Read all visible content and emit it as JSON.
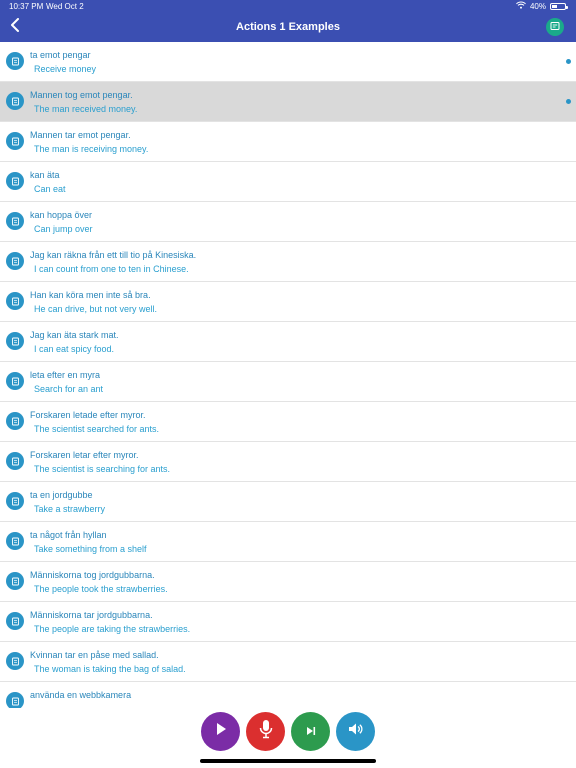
{
  "status_bar": {
    "time": "10:37 PM",
    "date": "Wed Oct 2",
    "battery_text": "40%",
    "battery_level": 0.4
  },
  "header": {
    "title": "Actions 1 Examples",
    "back_icon": "chevron-left-icon",
    "action_icon": "flashcard-icon"
  },
  "colors": {
    "nav_background": "#3b4fb2",
    "accent": "#2a95c7",
    "selected_row": "#d9d9d9",
    "play": "#7b2ca6",
    "record": "#db2f2f",
    "next": "#2d9b4e",
    "audio": "#2a95c7"
  },
  "examples": [
    {
      "primary": "ta emot pengar",
      "secondary": "Receive money",
      "selected": false,
      "dot": true
    },
    {
      "primary": "Mannen tog emot pengar.",
      "secondary": "The man received money.",
      "selected": true,
      "dot": true
    },
    {
      "primary": "Mannen tar emot pengar.",
      "secondary": "The man is receiving money.",
      "selected": false,
      "dot": false
    },
    {
      "primary": "kan äta",
      "secondary": "Can eat",
      "selected": false,
      "dot": false
    },
    {
      "primary": "kan hoppa över",
      "secondary": "Can jump over",
      "selected": false,
      "dot": false
    },
    {
      "primary": "Jag kan räkna från ett till tio på Kinesiska.",
      "secondary": "I can count from one to ten in Chinese.",
      "selected": false,
      "dot": false
    },
    {
      "primary": "Han kan köra men inte så bra.",
      "secondary": "He can drive, but not very well.",
      "selected": false,
      "dot": false
    },
    {
      "primary": "Jag kan äta stark mat.",
      "secondary": "I can eat spicy food.",
      "selected": false,
      "dot": false
    },
    {
      "primary": "leta efter en myra",
      "secondary": "Search for an ant",
      "selected": false,
      "dot": false
    },
    {
      "primary": "Forskaren letade efter myror.",
      "secondary": "The scientist searched for ants.",
      "selected": false,
      "dot": false
    },
    {
      "primary": "Forskaren letar efter myror.",
      "secondary": "The scientist is searching for ants.",
      "selected": false,
      "dot": false
    },
    {
      "primary": "ta en jordgubbe",
      "secondary": "Take a strawberry",
      "selected": false,
      "dot": false
    },
    {
      "primary": "ta något från hyllan",
      "secondary": "Take something from a shelf",
      "selected": false,
      "dot": false
    },
    {
      "primary": "Människorna tog jordgubbarna.",
      "secondary": "The people took the strawberries.",
      "selected": false,
      "dot": false
    },
    {
      "primary": "Människorna tar jordgubbarna.",
      "secondary": "The people are taking the strawberries.",
      "selected": false,
      "dot": false
    },
    {
      "primary": "Kvinnan tar en påse med sallad.",
      "secondary": "The woman is taking the bag of salad.",
      "selected": false,
      "dot": false
    },
    {
      "primary": "använda en webbkamera",
      "secondary": "",
      "selected": false,
      "dot": false
    }
  ],
  "controls": [
    {
      "name": "play-button",
      "icon": "play-icon",
      "color": "#7b2ca6"
    },
    {
      "name": "record-button",
      "icon": "microphone-icon",
      "color": "#db2f2f"
    },
    {
      "name": "next-button",
      "icon": "skip-next-icon",
      "color": "#2d9b4e"
    },
    {
      "name": "audio-button",
      "icon": "speaker-icon",
      "color": "#2a95c7"
    }
  ]
}
